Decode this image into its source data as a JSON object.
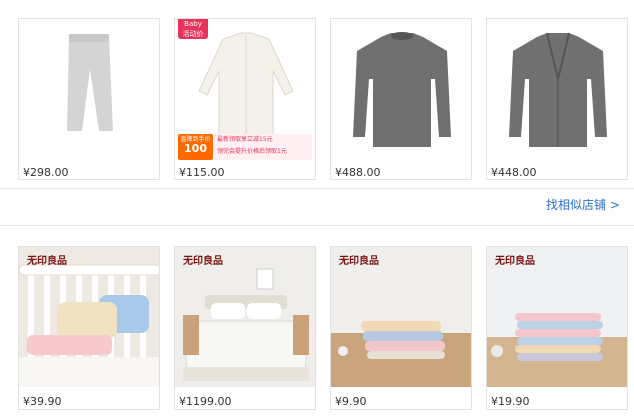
{
  "row1": [
    {
      "price": "¥298.00",
      "image": "gray-pants"
    },
    {
      "price": "¥115.00",
      "image": "white-shirt"
    },
    {
      "price": "¥488.00",
      "image": "gray-sweater"
    },
    {
      "price": "¥448.00",
      "image": "gray-cardigan"
    }
  ],
  "promo": {
    "tag_top": "Baby",
    "tag_bottom": "活动价",
    "label": "直降到手价",
    "amount": "100",
    "line1": "最新领取享立减15元",
    "line2": "领完会提升价格后领取1元"
  },
  "find_similar_shops": "找相似店铺 >",
  "row2": [
    {
      "brand": "无印良品",
      "price": "¥39.90",
      "image": "crib-bedding"
    },
    {
      "brand": "无印良品",
      "price": "¥1199.00",
      "image": "duvet-bed"
    },
    {
      "brand": "无印良品",
      "price": "¥9.90",
      "image": "folded-towels"
    },
    {
      "brand": "无印良品",
      "price": "¥19.90",
      "image": "stacked-towels"
    }
  ],
  "colors": {
    "link": "#2c6fc6",
    "brand": "#7a1414",
    "promo": "#e8335a"
  }
}
